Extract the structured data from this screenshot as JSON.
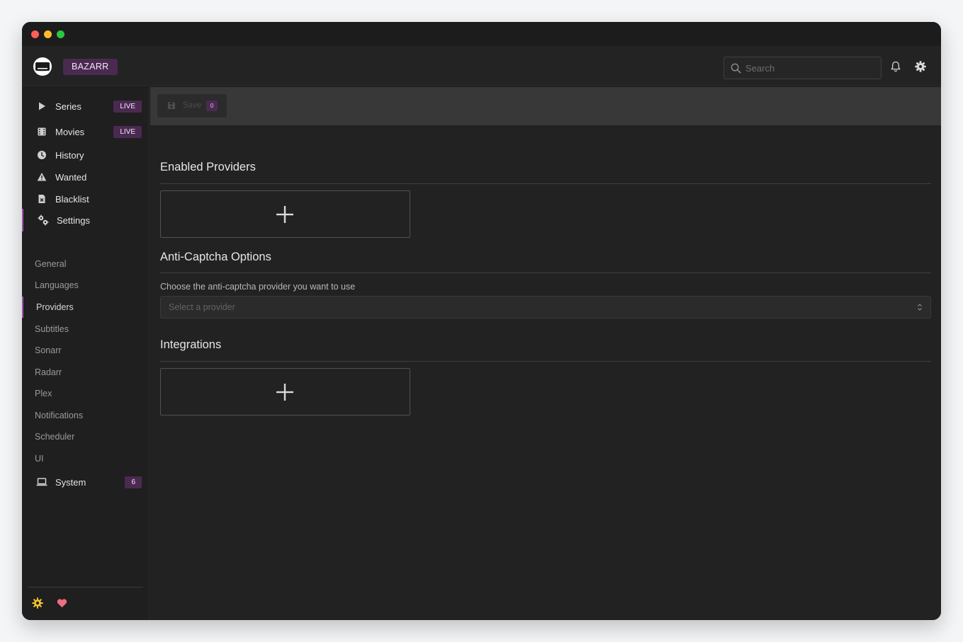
{
  "app": {
    "brand": "BAZARR"
  },
  "header": {
    "search_placeholder": "Search"
  },
  "sidebar": {
    "main_items": [
      {
        "label": "Series",
        "badge": "LIVE"
      },
      {
        "label": "Movies",
        "badge": "LIVE"
      },
      {
        "label": "History"
      },
      {
        "label": "Wanted"
      },
      {
        "label": "Blacklist"
      },
      {
        "label": "Settings"
      }
    ],
    "settings_items": [
      "General",
      "Languages",
      "Providers",
      "Subtitles",
      "Sonarr",
      "Radarr",
      "Plex",
      "Notifications",
      "Scheduler",
      "UI"
    ],
    "active_settings_item": "Providers",
    "system": {
      "label": "System",
      "badge": "6"
    }
  },
  "toolbar": {
    "save_label": "Save",
    "save_count": "0"
  },
  "content": {
    "enabled_providers_title": "Enabled Providers",
    "anticaptcha_title": "Anti-Captcha Options",
    "anticaptcha_help": "Choose the anti-captcha provider you want to use",
    "anticaptcha_placeholder": "Select a provider",
    "integrations_title": "Integrations"
  },
  "colors": {
    "accent": "#4b2a52",
    "active_indicator": "#a150b1",
    "footer_gear": "#f2c12e",
    "footer_heart": "#f06e7f"
  },
  "icons": {
    "series": "play-icon",
    "movies": "film-icon",
    "history": "clock-icon",
    "wanted": "warning-icon",
    "blacklist": "file-x-icon",
    "settings": "cogs-icon",
    "system": "laptop-icon",
    "search": "search-icon",
    "notifications": "bell-icon",
    "header_settings": "gear-icon",
    "add": "plus-icon",
    "footer_theme": "sun-gear-icon",
    "footer_donate": "heart-icon"
  }
}
